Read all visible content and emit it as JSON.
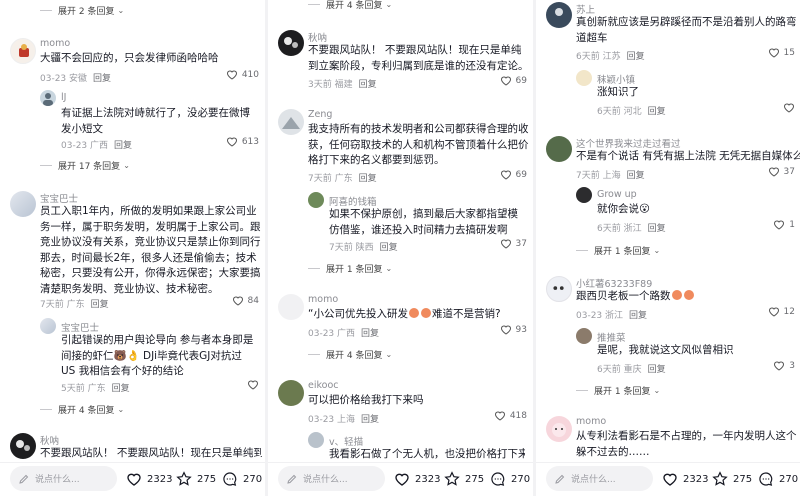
{
  "colors": {
    "text": "#161823",
    "meta": "#9a9ba1",
    "bg": "#ffffff"
  },
  "bottom_bar": {
    "placeholder": "说点什么...",
    "likes": "2323",
    "favorites": "275",
    "comments": "270",
    "icons": [
      "edit-icon",
      "heart-icon",
      "star-icon",
      "comment-icon"
    ]
  },
  "panel1": {
    "expand_top": "展开 2 条回复",
    "c1": {
      "user": "momo",
      "text": "大疆不会回应的，只会发律师函哈哈哈",
      "time": "03-23",
      "loc": "安徽",
      "reply": "回复",
      "likes": "410"
    },
    "c1r1": {
      "user": "lJ",
      "text": "有证据上法院对峙就行了，没必要在微博发小短文",
      "time": "03-23",
      "loc": "广西",
      "reply": "回复",
      "likes": "613"
    },
    "expand1": "展开 17 条回复",
    "c2": {
      "user": "宝宝巴士",
      "text": "员工入职1年内，所做的发明如果跟上家公司业务一样，属于职务发明，发明属于上家公司。跟竞业协议没有关系，竞业协议只是禁止你到同行那去，时间最长2年，很多人还是偷偷去；技术秘密，只要没有公开，你得永远保密；大家要搞清楚职务发明、竞业协议、技术秘密。",
      "time": "7天前",
      "loc": "广东",
      "reply": "回复",
      "likes": "84"
    },
    "c2r1": {
      "user": "宝宝巴士",
      "text_a": "引起错误的用户舆论导向 参与者本身即是间接的虾仁",
      "text_b": "DJi毕竟代表GJ对抗过US 我相信会有个好的结论",
      "time": "5天前",
      "loc": "广东",
      "reply": "回复"
    },
    "expand2": "展开 4 条回复",
    "c3": {
      "user": "秋呐",
      "text": "不要跟风站队！ 不要跟风站队！现在只是单纯到立"
    }
  },
  "panel2": {
    "expand_top": "展开 4 条回复",
    "c1": {
      "user": "秋呐",
      "text": "不要跟风站队！ 不要跟风站队！现在只是单纯到立案阶段，专利归属到底是谁的还没有定论。",
      "time": "3天前",
      "loc": "福建",
      "reply": "回复",
      "likes": "69"
    },
    "c2": {
      "user": "Zeng",
      "text": "我支持所有的技术发明者和公司都获得合理的收获，任何窃取技术的人和机构不管顶着什么把价格打下来的名义都要到惩罚。",
      "time": "7天前",
      "loc": "广东",
      "reply": "回复",
      "likes": "69"
    },
    "c2r1": {
      "user": "阿喜的钱箱",
      "text": "如果不保护原创，搞到最后大家都指望模仿借鉴，谁还投入时间精力去搞研发啊",
      "time": "7天前",
      "loc": "陕西",
      "reply": "回复",
      "likes": "37"
    },
    "expand1": "展开 1 条回复",
    "c3": {
      "user": "momo",
      "text_a": "“小公司优先投入研发",
      "text_b": "难道不是营销?",
      "time": "03-23",
      "loc": "广西",
      "reply": "回复",
      "likes": "93"
    },
    "expand2": "展开 4 条回复",
    "c4": {
      "user": "eikooc",
      "text": "可以把价格给我打下来吗",
      "time": "03-23",
      "loc": "上海",
      "reply": "回复",
      "likes": "418"
    },
    "c4r1": {
      "user": "v、轻描",
      "text": "我看影石做了个无人机，也没把价格打下来啊，"
    }
  },
  "panel3": {
    "c1": {
      "user": "苏上",
      "text": "真创新就应该是另辟蹊径而不是沿着别人的路弯道超车",
      "time": "6天前",
      "loc": "江苏",
      "reply": "回复",
      "likes": "15"
    },
    "c1r1": {
      "user": "秣颖小镇",
      "text": "涨知识了",
      "time": "6天前",
      "loc": "河北",
      "reply": "回复"
    },
    "c2": {
      "user": "这个世界我来过走过看过",
      "text": "不是有个说话 有凭有据上法院 无凭无据自媒体么",
      "time": "7天前",
      "loc": "上海",
      "reply": "回复",
      "likes": "37"
    },
    "c2r1": {
      "user": "Grow up",
      "text": "就你会说",
      "time": "6天前",
      "loc": "浙江",
      "reply": "回复",
      "likes": "1"
    },
    "expand1": "展开 1 条回复",
    "c3": {
      "user": "小红薯63233F89",
      "text": "跟西贝老板一个路数",
      "time": "03-23",
      "loc": "浙江",
      "reply": "回复",
      "likes": "12"
    },
    "c3r1": {
      "user": "推推菜",
      "text": "是呢，我就说这文风似曾相识",
      "time": "6天前",
      "loc": "重庆",
      "reply": "回复",
      "likes": "3"
    },
    "expand2": "展开 1 条回复",
    "c4": {
      "user": "momo",
      "text": "从专利法看影石是不占理的，一年内发明人这个躲不过去的……"
    }
  }
}
